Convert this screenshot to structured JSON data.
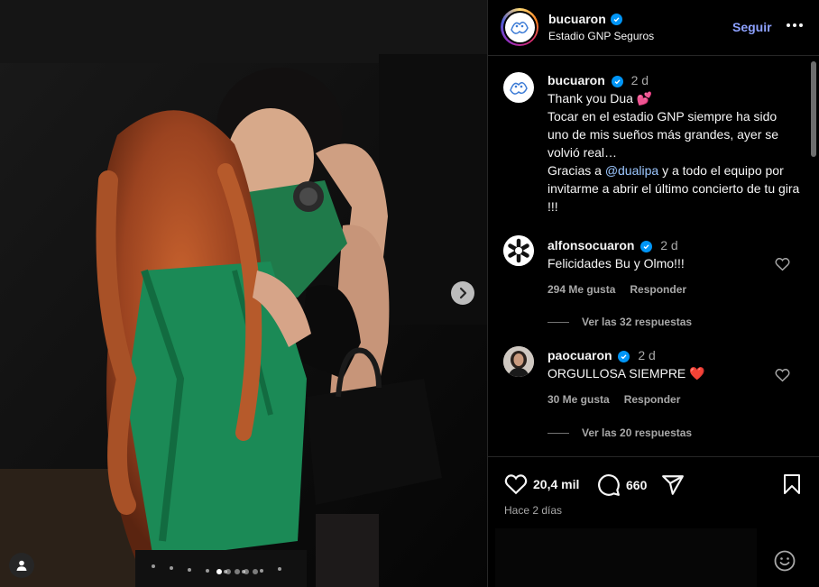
{
  "post": {
    "username": "bucuaron",
    "location": "Estadio GNP Seguros",
    "follow_label": "Seguir"
  },
  "caption": {
    "username": "bucuaron",
    "time": "2 d",
    "line1": "Thank you Dua ",
    "emoji1": "💕",
    "line2": "Tocar en el estadio GNP siempre ha sido uno de mis sueños más grandes, ayer se volvió real…",
    "line3a": "Gracias a ",
    "mention": "@dualipa",
    "line3b": " y a todo el equipo por invitarme a abrir el último concierto de tu gira !!!"
  },
  "comments": [
    {
      "username": "alfonsocuaron",
      "time": "2 d",
      "text": "Felicidades Bu y Olmo!!!",
      "likes": "294 Me gusta",
      "reply": "Responder",
      "view_replies": "Ver las 32 respuestas"
    },
    {
      "username": "paocuaron",
      "time": "2 d",
      "text": "ORGULLOSA SIEMPRE ",
      "emoji": "❤️",
      "likes": "30 Me gusta",
      "reply": "Responder",
      "view_replies": "Ver las 20 respuestas"
    }
  ],
  "stats": {
    "likes": "20,4 mil",
    "comments": "660",
    "posted": "Hace 2 días"
  },
  "icons": [
    "verified-icon",
    "more-icon",
    "heart-icon",
    "comment-icon",
    "share-icon",
    "bookmark-icon",
    "emoji-icon",
    "chevron-right-icon",
    "user-tag-icon"
  ],
  "colors": {
    "accent": "#8da1ff",
    "verified": "#0095f6",
    "background": "#000000",
    "muted": "#a8a8a8"
  }
}
